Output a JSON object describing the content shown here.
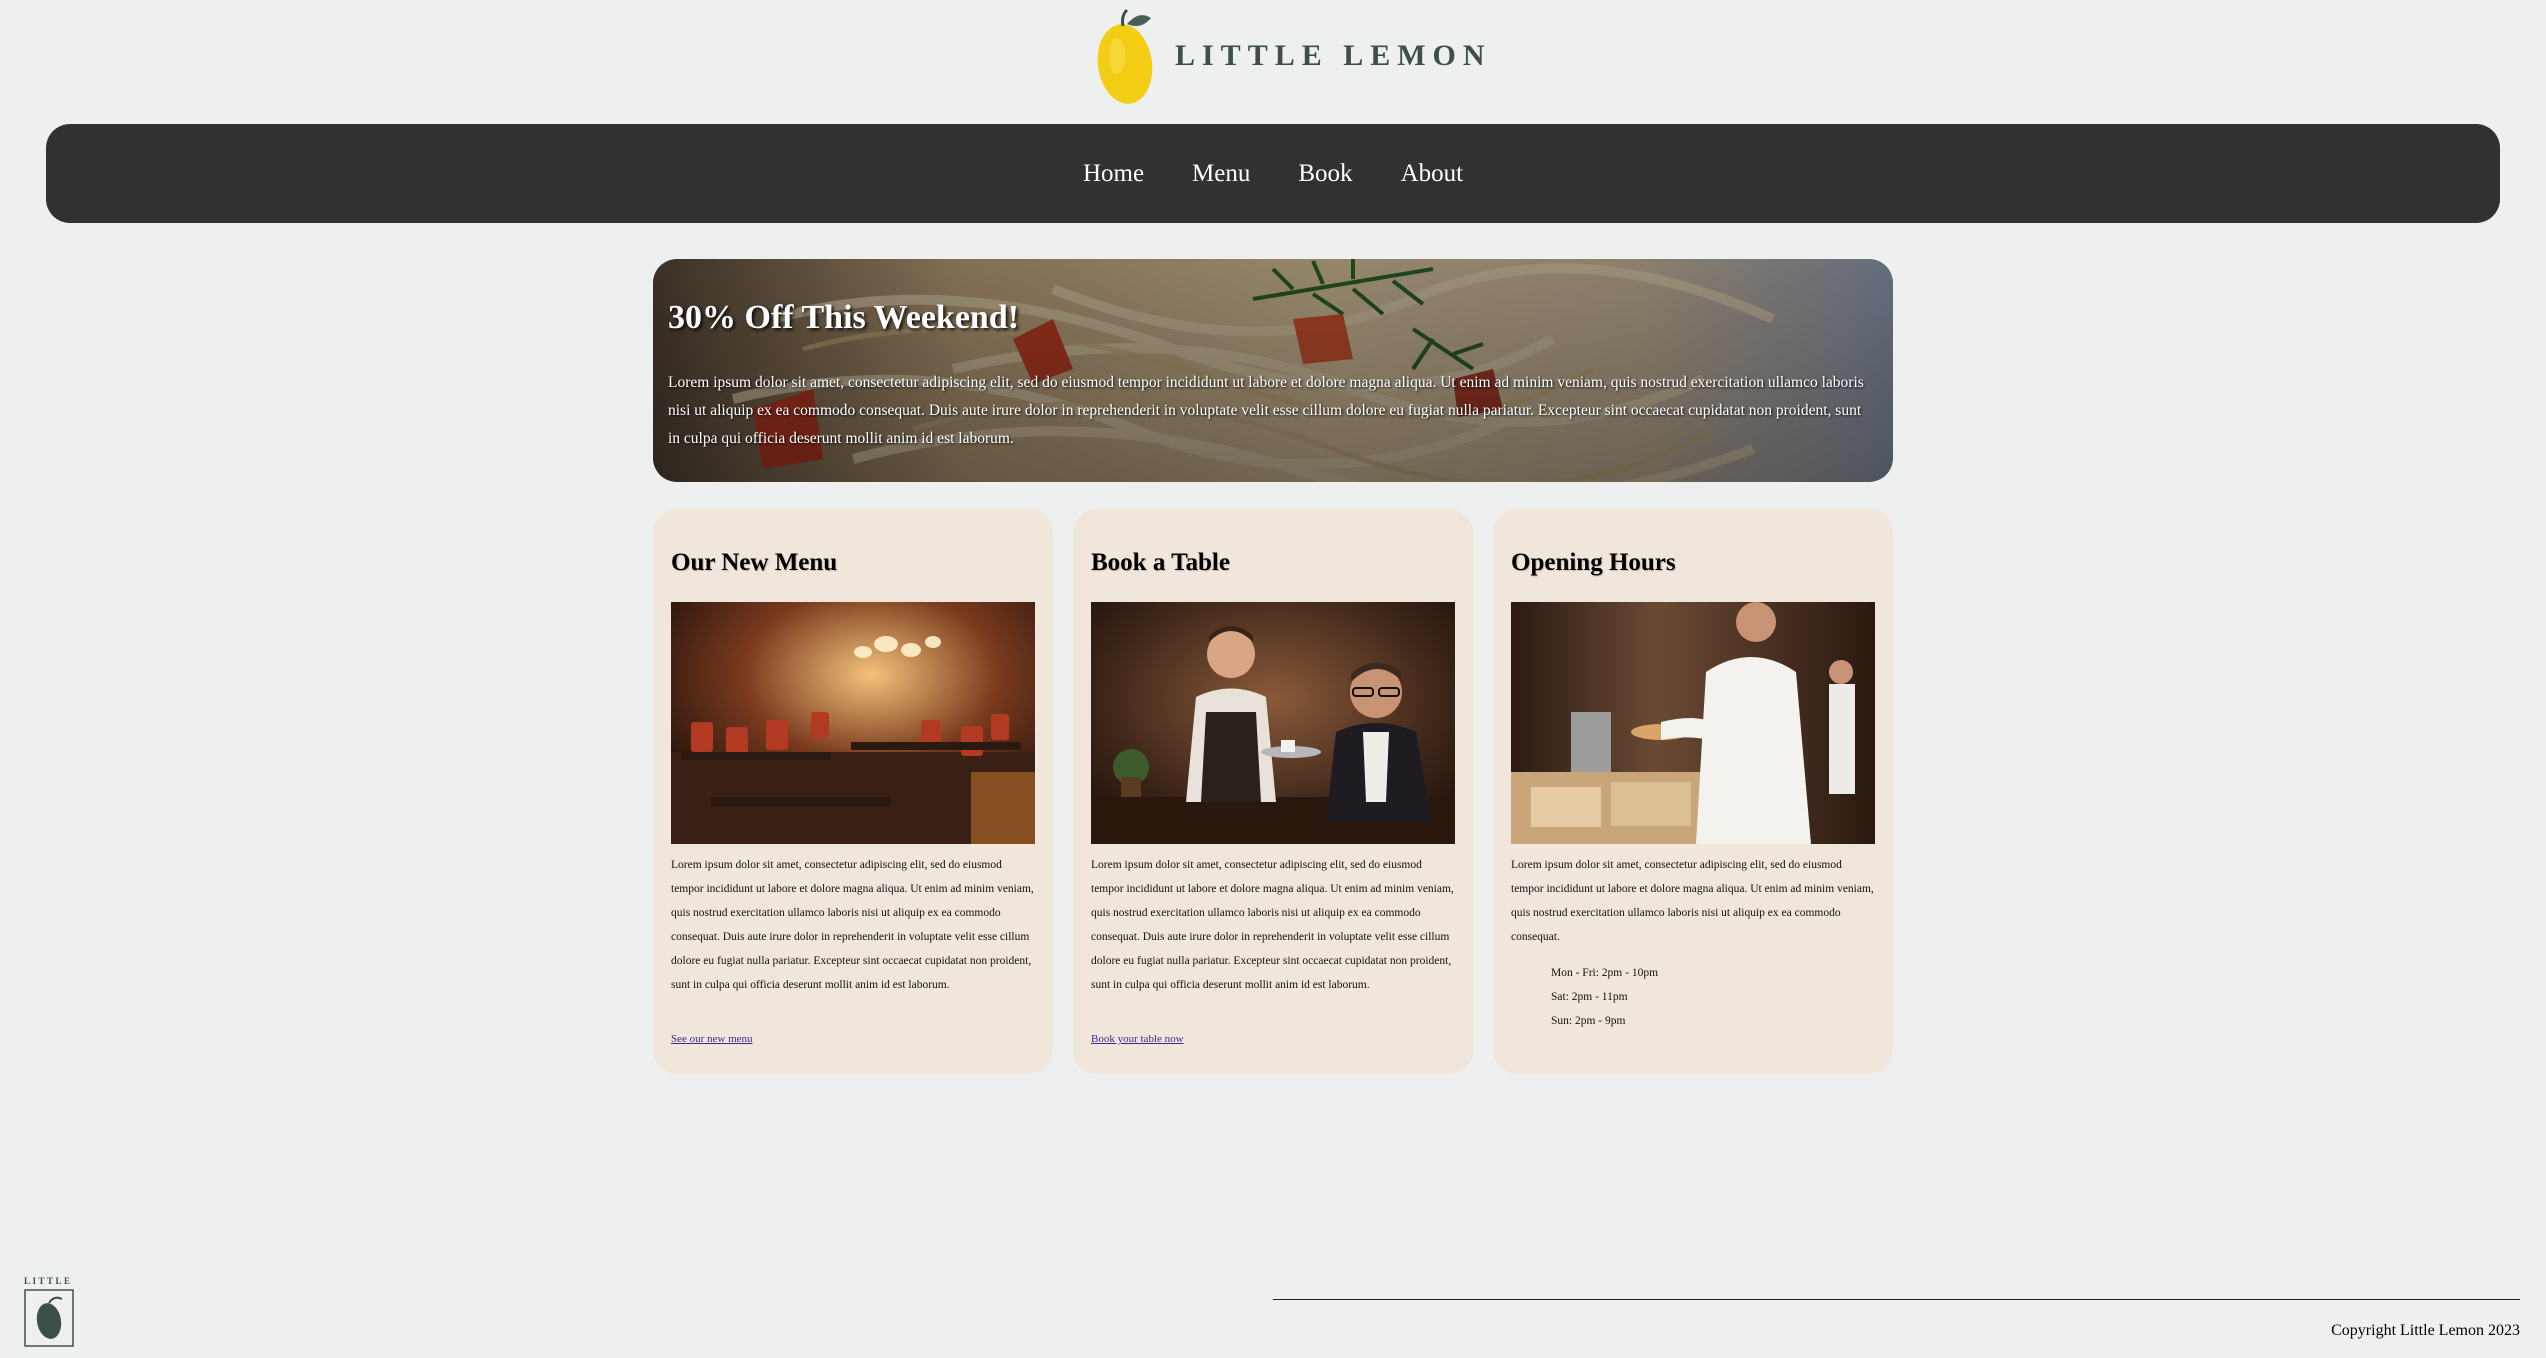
{
  "brand": {
    "name": "LITTLE LEMON",
    "footer_mark": "LITTLE"
  },
  "nav": {
    "items": [
      {
        "label": "Home"
      },
      {
        "label": "Menu"
      },
      {
        "label": "Book"
      },
      {
        "label": "About"
      }
    ]
  },
  "hero": {
    "title": "30% Off This Weekend!",
    "text": "Lorem ipsum dolor sit amet, consectetur adipiscing elit, sed do eiusmod tempor incididunt ut labore et dolore magna aliqua. Ut enim ad minim veniam, quis nostrud exercitation ullamco laboris nisi ut aliquip ex ea commodo consequat. Duis aute irure dolor in reprehenderit in voluptate velit esse cillum dolore eu fugiat nulla pariatur. Excepteur sint occaecat cupidatat non proident, sunt in culpa qui officia deserunt mollit anim id est laborum."
  },
  "cards": [
    {
      "title": "Our New Menu",
      "image": "restaurant-interior-photo",
      "text": "Lorem ipsum dolor sit amet, consectetur adipiscing elit, sed do eiusmod tempor incididunt ut labore et dolore magna aliqua. Ut enim ad minim veniam, quis nostrud exercitation ullamco laboris nisi ut aliquip ex ea commodo consequat. Duis aute irure dolor in reprehenderit in voluptate velit esse cillum dolore eu fugiat nulla pariatur. Excepteur sint occaecat cupidatat non proident, sunt in culpa qui officia deserunt mollit anim id est laborum.",
      "link": "See our new menu"
    },
    {
      "title": "Book a Table",
      "image": "waiter-serving-photo",
      "text": "Lorem ipsum dolor sit amet, consectetur adipiscing elit, sed do eiusmod tempor incididunt ut labore et dolore magna aliqua. Ut enim ad minim veniam, quis nostrud exercitation ullamco laboris nisi ut aliquip ex ea commodo consequat. Duis aute irure dolor in reprehenderit in voluptate velit esse cillum dolore eu fugiat nulla pariatur. Excepteur sint occaecat cupidatat non proident, sunt in culpa qui officia deserunt mollit anim id est laborum.",
      "link": "Book your table now"
    },
    {
      "title": "Opening Hours",
      "image": "chef-kitchen-photo",
      "text": "Lorem ipsum dolor sit amet, consectetur adipiscing elit, sed do eiusmod tempor incididunt ut labore et dolore magna aliqua. Ut enim ad minim veniam, quis nostrud exercitation ullamco laboris nisi ut aliquip ex ea commodo consequat.",
      "hours": [
        "Mon - Fri: 2pm - 10pm",
        "Sat: 2pm - 11pm",
        "Sun: 2pm - 9pm"
      ]
    }
  ],
  "footer": {
    "copyright": "Copyright Little Lemon 2023"
  },
  "colors": {
    "page_bg": "#eef0ef",
    "nav_bg": "#313131",
    "card_bg": "#f1e6dc",
    "lemon_yellow": "#f4ce14",
    "brand_green": "#3e4f48"
  }
}
